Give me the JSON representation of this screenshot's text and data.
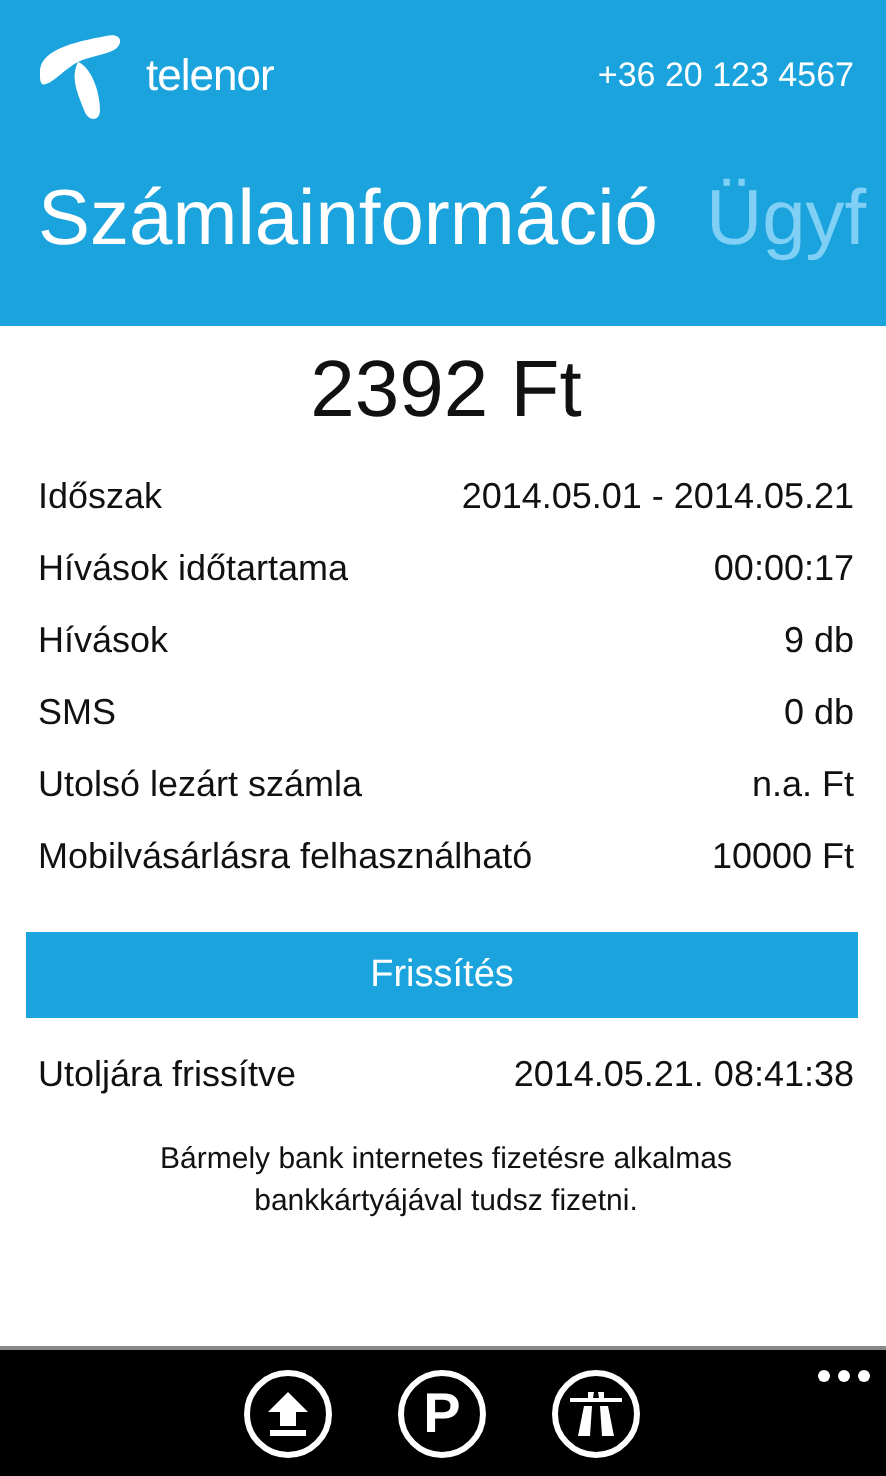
{
  "header": {
    "brand": "telenor",
    "phone": "+36 20 123 4567"
  },
  "pivot": [
    {
      "label": "Számlainformáció",
      "selected": true
    },
    {
      "label": "Ügyf",
      "selected": false
    }
  ],
  "amount": "2392 Ft",
  "details": [
    {
      "label": "Időszak",
      "value": "2014.05.01 - 2014.05.21"
    },
    {
      "label": "Hívások időtartama",
      "value": "00:00:17"
    },
    {
      "label": "Hívások",
      "value": "9 db"
    },
    {
      "label": "SMS",
      "value": "0 db"
    },
    {
      "label": "Utolsó lezárt számla",
      "value": "n.a. Ft"
    },
    {
      "label": "Mobilvásárlásra felhasználható",
      "value": "10000 Ft"
    }
  ],
  "refresh_button": "Frissítés",
  "last_updated": {
    "label": "Utoljára frissítve",
    "value": "2014.05.21. 08:41:38"
  },
  "note": "Bármely bank internetes fizetésre alkalmas bankkártyájával tudsz fizetni.",
  "app_bar": [
    {
      "kind": "upload"
    },
    {
      "kind": "letter",
      "glyph": "P"
    },
    {
      "kind": "road"
    }
  ]
}
